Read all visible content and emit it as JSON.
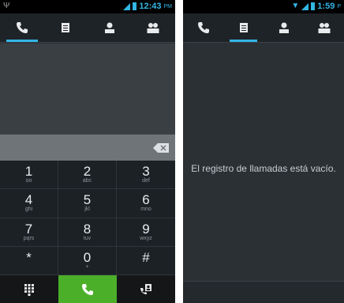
{
  "left_screen": {
    "status": {
      "time": "12:43",
      "ampm": "PM"
    },
    "tabs": [
      {
        "name": "phone",
        "icon": "phone-icon",
        "active": true
      },
      {
        "name": "call-log",
        "icon": "list-icon",
        "active": false
      },
      {
        "name": "contacts",
        "icon": "person-icon",
        "active": false
      },
      {
        "name": "favorites",
        "icon": "group-icon",
        "active": false
      }
    ],
    "keys": [
      {
        "num": "1",
        "sub": "oo"
      },
      {
        "num": "2",
        "sub": "abc"
      },
      {
        "num": "3",
        "sub": "def"
      },
      {
        "num": "4",
        "sub": "ghi"
      },
      {
        "num": "5",
        "sub": "jkl"
      },
      {
        "num": "6",
        "sub": "mno"
      },
      {
        "num": "7",
        "sub": "pqrs"
      },
      {
        "num": "8",
        "sub": "tuv"
      },
      {
        "num": "9",
        "sub": "wxyz"
      },
      {
        "num": "*",
        "sub": ""
      },
      {
        "num": "0",
        "sub": "+"
      },
      {
        "num": "#",
        "sub": ""
      }
    ],
    "actions": [
      "dialpad-icon",
      "call-icon",
      "contact-card-icon"
    ]
  },
  "right_screen": {
    "status": {
      "time": "1:59",
      "ampm": "P"
    },
    "empty_message": "El registro de llamadas está vacío."
  },
  "colors": {
    "accent": "#33b5e5",
    "call_green": "#4caf2a"
  }
}
